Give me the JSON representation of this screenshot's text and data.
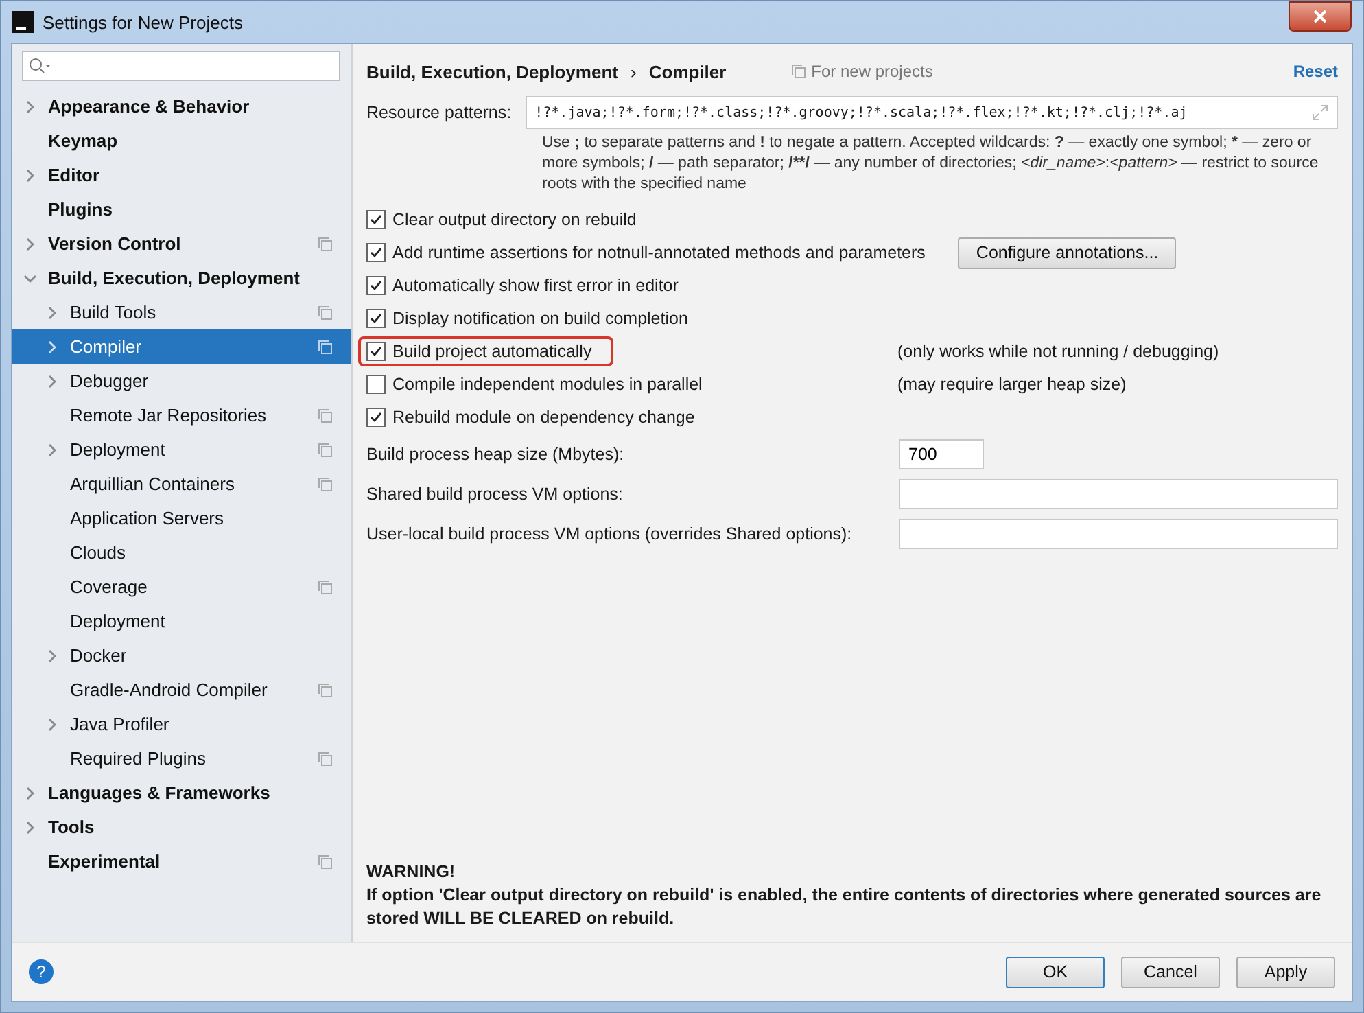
{
  "window": {
    "title": "Settings for New Projects"
  },
  "sidebar": {
    "items": [
      {
        "label": "Appearance & Behavior",
        "kind": "collapsed",
        "selected": false,
        "project_icon": false
      },
      {
        "label": "Keymap",
        "kind": "leaf",
        "selected": false,
        "project_icon": false
      },
      {
        "label": "Editor",
        "kind": "collapsed",
        "selected": false,
        "project_icon": false
      },
      {
        "label": "Plugins",
        "kind": "leaf",
        "selected": false,
        "project_icon": false
      },
      {
        "label": "Version Control",
        "kind": "collapsed",
        "selected": false,
        "project_icon": true
      },
      {
        "label": "Build, Execution, Deployment",
        "kind": "expanded",
        "selected": false,
        "project_icon": false,
        "children": [
          {
            "label": "Build Tools",
            "kind": "collapsed",
            "selected": false,
            "project_icon": true
          },
          {
            "label": "Compiler",
            "kind": "collapsed",
            "selected": true,
            "project_icon": true
          },
          {
            "label": "Debugger",
            "kind": "collapsed",
            "selected": false,
            "project_icon": false
          },
          {
            "label": "Remote Jar Repositories",
            "kind": "leaf",
            "selected": false,
            "project_icon": true
          },
          {
            "label": "Deployment",
            "kind": "collapsed",
            "selected": false,
            "project_icon": true
          },
          {
            "label": "Arquillian Containers",
            "kind": "leaf",
            "selected": false,
            "project_icon": true
          },
          {
            "label": "Application Servers",
            "kind": "leaf",
            "selected": false,
            "project_icon": false
          },
          {
            "label": "Clouds",
            "kind": "leaf",
            "selected": false,
            "project_icon": false
          },
          {
            "label": "Coverage",
            "kind": "leaf",
            "selected": false,
            "project_icon": true
          },
          {
            "label": "Deployment",
            "kind": "leaf",
            "selected": false,
            "project_icon": false
          },
          {
            "label": "Docker",
            "kind": "collapsed",
            "selected": false,
            "project_icon": false
          },
          {
            "label": "Gradle-Android Compiler",
            "kind": "leaf",
            "selected": false,
            "project_icon": true
          },
          {
            "label": "Java Profiler",
            "kind": "collapsed",
            "selected": false,
            "project_icon": false
          },
          {
            "label": "Required Plugins",
            "kind": "leaf",
            "selected": false,
            "project_icon": true
          }
        ]
      },
      {
        "label": "Languages & Frameworks",
        "kind": "collapsed",
        "selected": false,
        "project_icon": false
      },
      {
        "label": "Tools",
        "kind": "collapsed",
        "selected": false,
        "project_icon": false
      },
      {
        "label": "Experimental",
        "kind": "leaf",
        "selected": false,
        "project_icon": true
      }
    ]
  },
  "header": {
    "breadcrumb": [
      "Build, Execution, Deployment",
      "Compiler"
    ],
    "separator": "›",
    "scope": "For new projects",
    "reset": "Reset"
  },
  "resource_patterns": {
    "label": "Resource patterns:",
    "value": "!?*.java;!?*.form;!?*.class;!?*.groovy;!?*.scala;!?*.flex;!?*.kt;!?*.clj;!?*.aj",
    "help": [
      {
        "text": "Use ",
        "kind": "plain"
      },
      {
        "text": ";",
        "kind": "symbol"
      },
      {
        "text": " to separate patterns and ",
        "kind": "plain"
      },
      {
        "text": "!",
        "kind": "symbol"
      },
      {
        "text": " to negate a pattern. Accepted wildcards: ",
        "kind": "plain"
      },
      {
        "text": "?",
        "kind": "symbol"
      },
      {
        "text": " — exactly one symbol; ",
        "kind": "plain"
      },
      {
        "text": "*",
        "kind": "symbol"
      },
      {
        "text": " — zero or more symbols; ",
        "kind": "plain"
      },
      {
        "text": "/",
        "kind": "symbol"
      },
      {
        "text": " — path separator; ",
        "kind": "plain"
      },
      {
        "text": "/**/",
        "kind": "symbol"
      },
      {
        "text": " — any number of directories; ",
        "kind": "plain"
      },
      {
        "text": "<dir_name>",
        "kind": "variable"
      },
      {
        "text": ":",
        "kind": "plain"
      },
      {
        "text": "<pattern>",
        "kind": "variable"
      },
      {
        "text": " — restrict to source roots with the specified name",
        "kind": "plain"
      }
    ]
  },
  "options": [
    {
      "label": "Clear output directory on rebuild",
      "checked": true,
      "highlighted": false
    },
    {
      "label": "Add runtime assertions for notnull-annotated methods and parameters",
      "checked": true,
      "highlighted": false,
      "button": "Configure annotations..."
    },
    {
      "label": "Automatically show first error in editor",
      "checked": true,
      "highlighted": false
    },
    {
      "label": "Display notification on build completion",
      "checked": true,
      "highlighted": false
    },
    {
      "label": "Build project automatically",
      "checked": true,
      "highlighted": true,
      "note": "(only works while not running / debugging)"
    },
    {
      "label": "Compile independent modules in parallel",
      "checked": false,
      "highlighted": false,
      "note": "(may require larger heap size)"
    },
    {
      "label": "Rebuild module on dependency change",
      "checked": true,
      "highlighted": false
    }
  ],
  "fields": [
    {
      "label": "Build process heap size (Mbytes):",
      "value": "700",
      "kind": "short"
    },
    {
      "label": "Shared build process VM options:",
      "kind": "wide"
    },
    {
      "label": "User-local build process VM options (overrides Shared options):",
      "kind": "wide"
    }
  ],
  "warning": {
    "title": "WARNING!",
    "text": "If option 'Clear output directory on rebuild' is enabled, the entire contents of directories where generated sources are stored WILL BE CLEARED on rebuild."
  },
  "help_button": "?",
  "buttons": [
    {
      "label": "OK",
      "kind": "default"
    },
    {
      "label": "Cancel",
      "kind": "normal"
    },
    {
      "label": "Apply",
      "kind": "normal"
    }
  ]
}
